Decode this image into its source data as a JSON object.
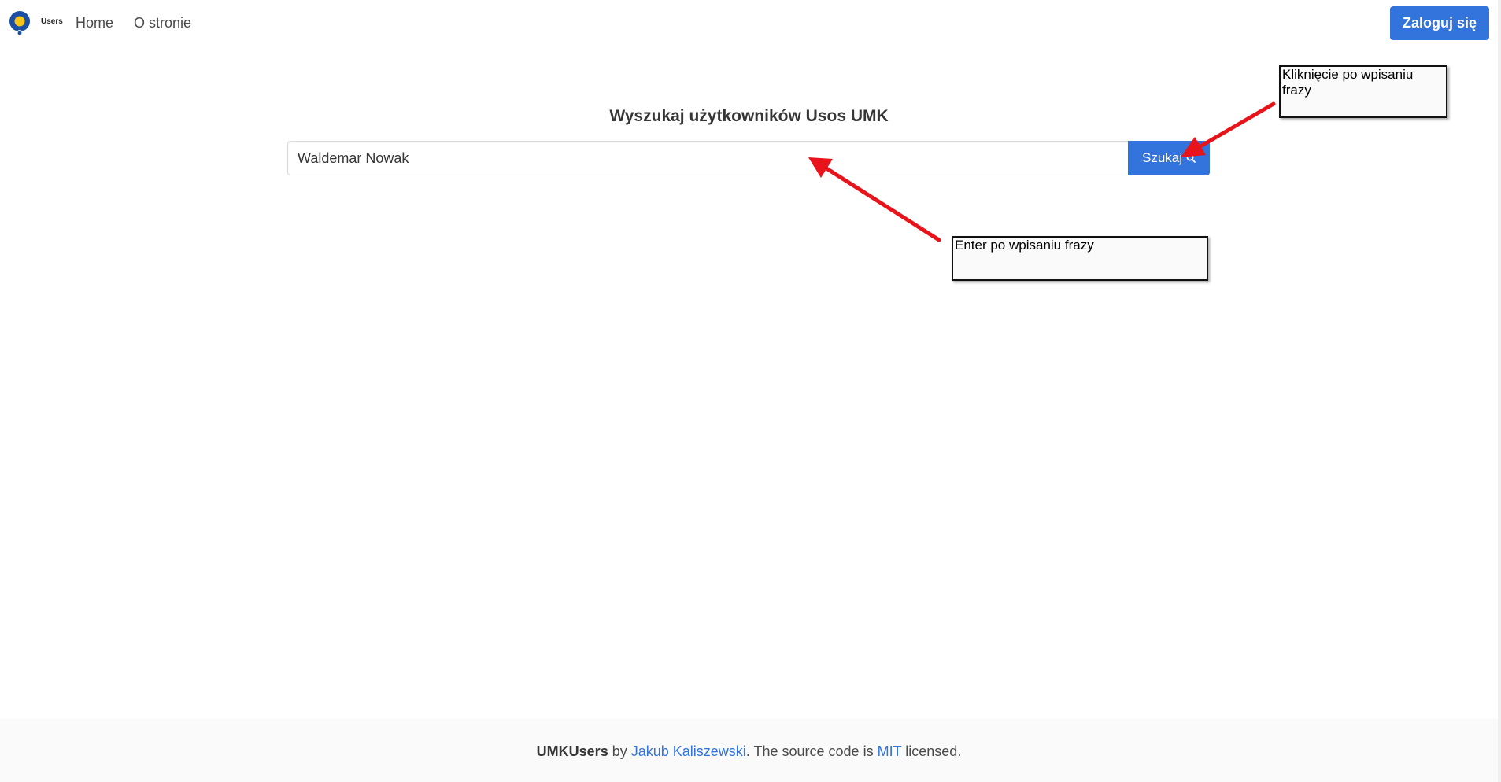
{
  "navbar": {
    "logo_text": "Users",
    "links": [
      {
        "label": "Home"
      },
      {
        "label": "O stronie"
      }
    ],
    "login_label": "Zaloguj się"
  },
  "search": {
    "title": "Wyszukaj użytkowników Usos UMK",
    "value": "Waldemar Nowak",
    "button_label": "Szukaj",
    "button_icon": "search-icon"
  },
  "annotations": [
    {
      "text": "Kliknięcie po wpisaniu frazy"
    },
    {
      "text": "Enter po wpisaniu frazy"
    }
  ],
  "footer": {
    "brand": "UMKUsers",
    "by": "by",
    "author": "Jakub Kaliszewski",
    "middle": ". The source code is",
    "license": "MIT",
    "end": "licensed."
  },
  "colors": {
    "primary": "#3273dc",
    "annotation_arrow": "#e8141b",
    "logo_blue": "#1b4fa3",
    "logo_yellow": "#f5c518"
  }
}
